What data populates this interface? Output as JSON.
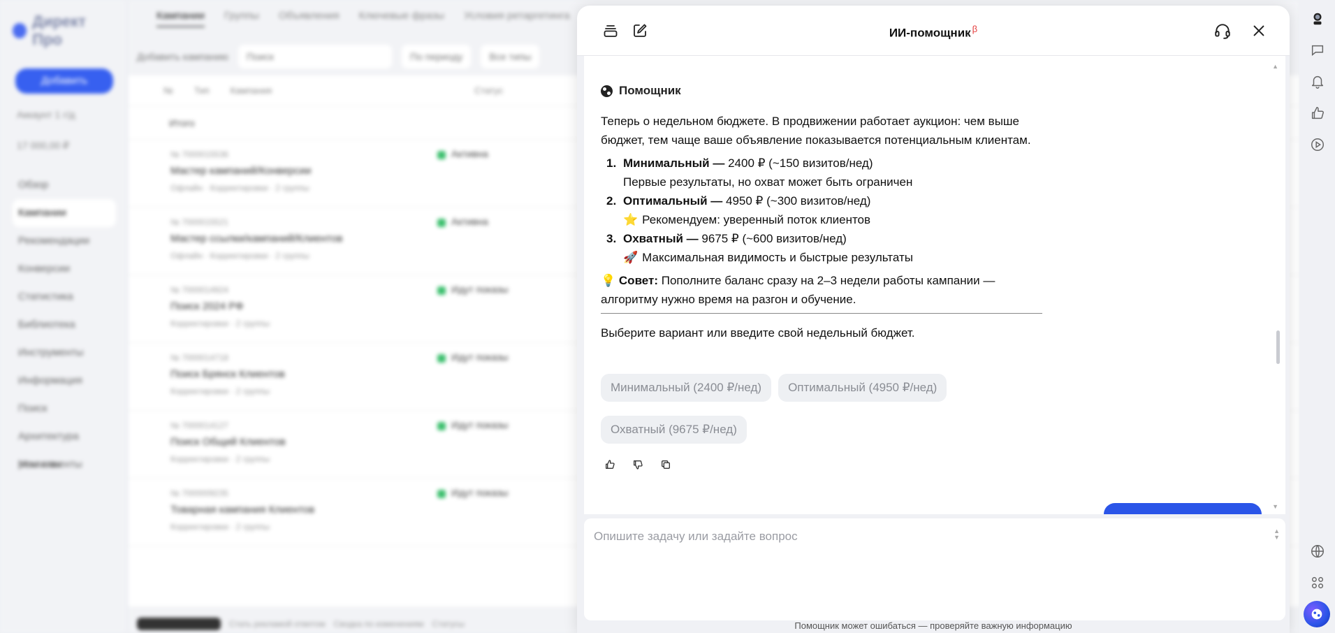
{
  "background": {
    "logo": "Директ Про",
    "create_label": "Добавить",
    "account": "Аккаунт 1 г/д",
    "balance": "17 000,00 ₽",
    "nav": [
      "Обзор",
      "Кампании",
      "Рекомендации",
      "Конверсии",
      "Статистика",
      "Библиотека",
      "Инструменты",
      "Информация",
      "Поиск",
      "Архитектура рекламы",
      "Мои клиенты"
    ],
    "tabs": [
      "Кампании",
      "Группы",
      "Объявления",
      "Ключевые фразы",
      "Условия ретаргетинга"
    ],
    "filters": [
      "Добавить кампанию",
      "Поиск",
      "По периоду",
      "Все типы"
    ],
    "table_headers": [
      "№",
      "Тип",
      "Кампания",
      "Статус"
    ],
    "total_label": "Итого",
    "rows": [
      {
        "id": "№ 7000015536",
        "name": "Мастер кампаний/Конверсии",
        "sub": "Офлайн · Корректировки · 2 группы",
        "status": "Активна"
      },
      {
        "id": "№ 7000015521",
        "name": "Мастер ссылки/кампаний/Клиентов",
        "sub": "Офлайн · Корректировки · 2 группы",
        "status": "Активна"
      },
      {
        "id": "№ 7000014924",
        "name": "Поиск 2024 РФ",
        "sub": "Корректировки · 2 группы",
        "status": "Идут показы"
      },
      {
        "id": "№ 7000014718",
        "name": "Поиск Брянск Клиентов",
        "sub": "Корректировки · 2 группы",
        "status": "Идут показы"
      },
      {
        "id": "№ 7000014127",
        "name": "Поиск Общий Клиентов",
        "sub": "Корректировки · 2 группы",
        "status": "Идут показы"
      },
      {
        "id": "№ 7000009235",
        "name": "Товарная кампания Клиентов",
        "sub": "Корректировки · 2 группы",
        "status": "Идут показы"
      }
    ],
    "footer": [
      "Показать все",
      "Стать рекламой ответом",
      "Сводка по изменениям",
      "Статусы"
    ]
  },
  "panel": {
    "title": "ИИ-помощник",
    "beta": "β",
    "author": "Помощник",
    "intro": "Теперь о недельном бюджете. В продвижении работает аукцион: чем выше бюджет, тем чаще ваше объявление показывается потенциальным клиентам.",
    "options": [
      {
        "num": "1.",
        "name": "Минимальный —",
        "value": " 2400 ₽ (~150 визитов/нед)",
        "emoji": "",
        "desc": "Первые результаты, но охват может быть ограничен"
      },
      {
        "num": "2.",
        "name": "Оптимальный —",
        "value": " 4950 ₽ (~300 визитов/нед)",
        "emoji": "⭐",
        "desc": "Рекомендуем: уверенный поток клиентов"
      },
      {
        "num": "3.",
        "name": "Охватный —",
        "value": " 9675 ₽ (~600 визитов/нед)",
        "emoji": "🚀",
        "desc": "Максимальная видимость и быстрые результаты"
      }
    ],
    "tip_emoji": "💡",
    "tip_label": "Совет:",
    "tip_text": " Пополните баланс сразу на 2–3 недели работы кампании — алгоритму нужно время на разгон и обучение.",
    "choose_text": "Выберите вариант или введите свой недельный бюджет.",
    "chips": [
      "Минимальный (2400 ₽/нед)",
      "Оптимальный (4950 ₽/нед)",
      "Охватный (9675 ₽/нед)"
    ],
    "input_placeholder": "Опишите задачу или задайте вопрос",
    "disclaimer": "Помощник может ошибаться — проверяйте важную информацию"
  },
  "colors": {
    "accent": "#2b55e8",
    "beta": "#e43b3b",
    "status_green": "#3cbf6e"
  }
}
